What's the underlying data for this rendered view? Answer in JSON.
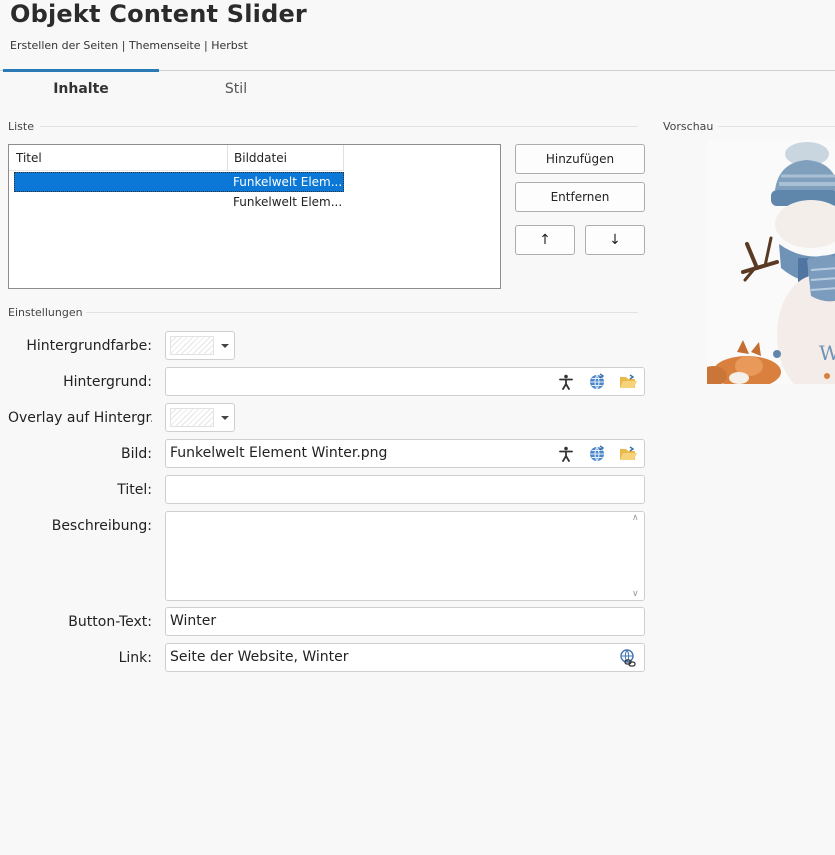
{
  "header": {
    "title": "Objekt Content Slider",
    "breadcrumb": "Erstellen der Seiten | Themenseite | Herbst"
  },
  "tabs": [
    {
      "label": "Inhalte",
      "active": true
    },
    {
      "label": "Stil",
      "active": false
    }
  ],
  "list": {
    "section_label": "Liste",
    "columns": [
      "Titel",
      "Bilddatei"
    ],
    "rows": [
      {
        "titel": "",
        "bilddatei": "Funkelwelt Elem...",
        "selected": true
      },
      {
        "titel": "",
        "bilddatei": "Funkelwelt Elem...",
        "selected": false
      }
    ],
    "buttons": {
      "add": "Hinzufügen",
      "remove": "Entfernen",
      "up": "↑",
      "down": "↓"
    }
  },
  "preview": {
    "label": "Vorschau"
  },
  "settings": {
    "section_label": "Einstellungen",
    "hintergrundfarbe": {
      "label": "Hintergrundfarbe:"
    },
    "hintergrund": {
      "label": "Hintergrund:",
      "value": ""
    },
    "overlay": {
      "label": "Overlay auf Hintergr..."
    },
    "bild": {
      "label": "Bild:",
      "value": "Funkelwelt Element Winter.png"
    },
    "titel": {
      "label": "Titel:",
      "value": ""
    },
    "beschreibung": {
      "label": "Beschreibung:",
      "value": ""
    },
    "button_text": {
      "label": "Button-Text:",
      "value": "Winter"
    },
    "link": {
      "label": "Link:",
      "value": "Seite der Website, Winter"
    }
  },
  "colors": {
    "accent": "#2a7ab5",
    "selection": "#0b78d7"
  }
}
